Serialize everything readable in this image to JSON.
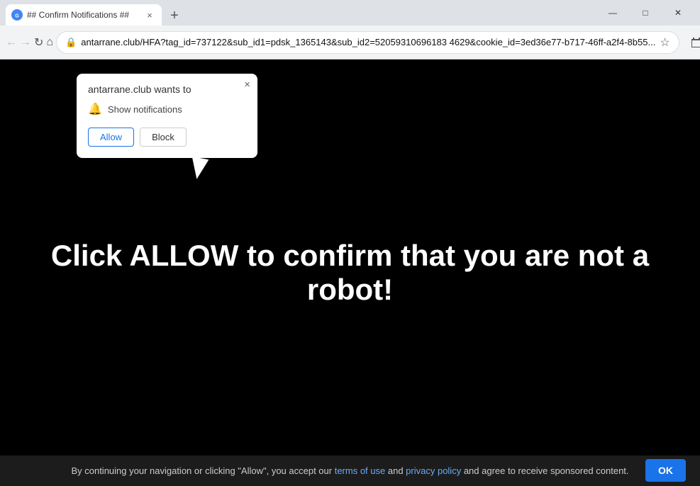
{
  "browser": {
    "tab": {
      "favicon_label": "##",
      "title": "## Confirm Notifications ##",
      "close_label": "×"
    },
    "new_tab_label": "+",
    "window_controls": {
      "minimize": "—",
      "maximize": "□",
      "close": "✕"
    },
    "toolbar": {
      "back_icon": "←",
      "forward_icon": "→",
      "reload_icon": "↻",
      "home_icon": "⌂",
      "url": "antarrane.club/HFA?tag_id=737122&sub_id1=pdsk_1365143&sub_id2=52059310696183 4629&cookie_id=3ed36e77-b717-46ff-a2f4-8b55...",
      "star_icon": "☆",
      "extensions_icon": "⚙",
      "account_icon": "○",
      "menu_icon": "⋮"
    }
  },
  "notification_popup": {
    "title": "antarrane.club wants to",
    "close_label": "×",
    "description": "Show notifications",
    "allow_label": "Allow",
    "block_label": "Block"
  },
  "page": {
    "main_text": "Click ALLOW to confirm that you are not a robot!"
  },
  "consent_bar": {
    "text_before": "By continuing your navigation or clicking \"Allow\", you accept our ",
    "terms_label": "terms of use",
    "text_middle": " and ",
    "privacy_label": "privacy policy",
    "text_after": " and agree to receive sponsored content.",
    "ok_label": "OK"
  }
}
